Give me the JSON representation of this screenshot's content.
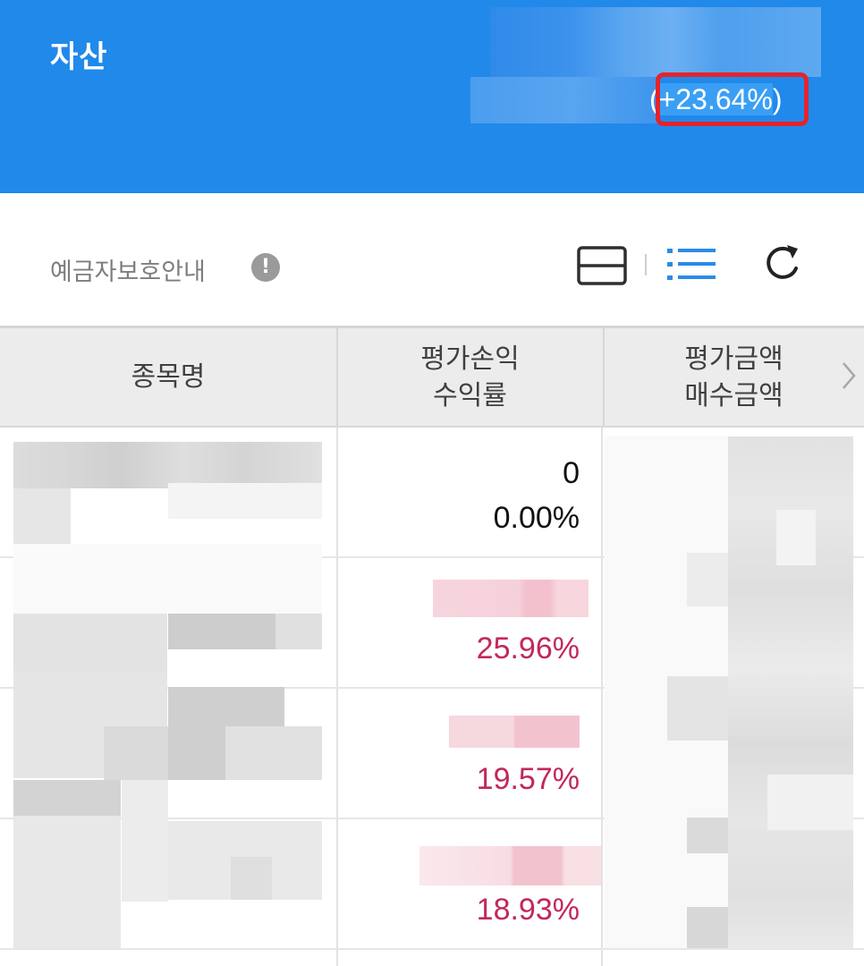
{
  "header": {
    "title": "자산",
    "return_rate_open": "(",
    "return_rate_value": "+23.64%",
    "return_rate_close": ")"
  },
  "toolbar": {
    "deposit_protection_label": "예금자보호안내",
    "info_icon": "info-icon",
    "info_glyph": "!",
    "view_icons": [
      "card-view-icon",
      "list-view-icon"
    ],
    "refresh_icon": "refresh-icon"
  },
  "table": {
    "headers": {
      "name": "종목명",
      "pl_line1": "평가손익",
      "pl_line2": "수익률",
      "amount_line1": "평가금액",
      "amount_line2": "매수금액"
    },
    "rows": [
      {
        "profit_loss": "0",
        "return_rate": "0.00%",
        "tone": "neutral"
      },
      {
        "profit_loss": "",
        "return_rate": "25.96%",
        "tone": "positive"
      },
      {
        "profit_loss": "",
        "return_rate": "19.57%",
        "tone": "positive"
      },
      {
        "profit_loss": "",
        "return_rate": "18.93%",
        "tone": "positive"
      }
    ]
  },
  "colors": {
    "header_bg": "#2189ea",
    "highlight_box": "#e5232a",
    "positive": "#c2285a",
    "accent_icon": "#2a8be8"
  }
}
